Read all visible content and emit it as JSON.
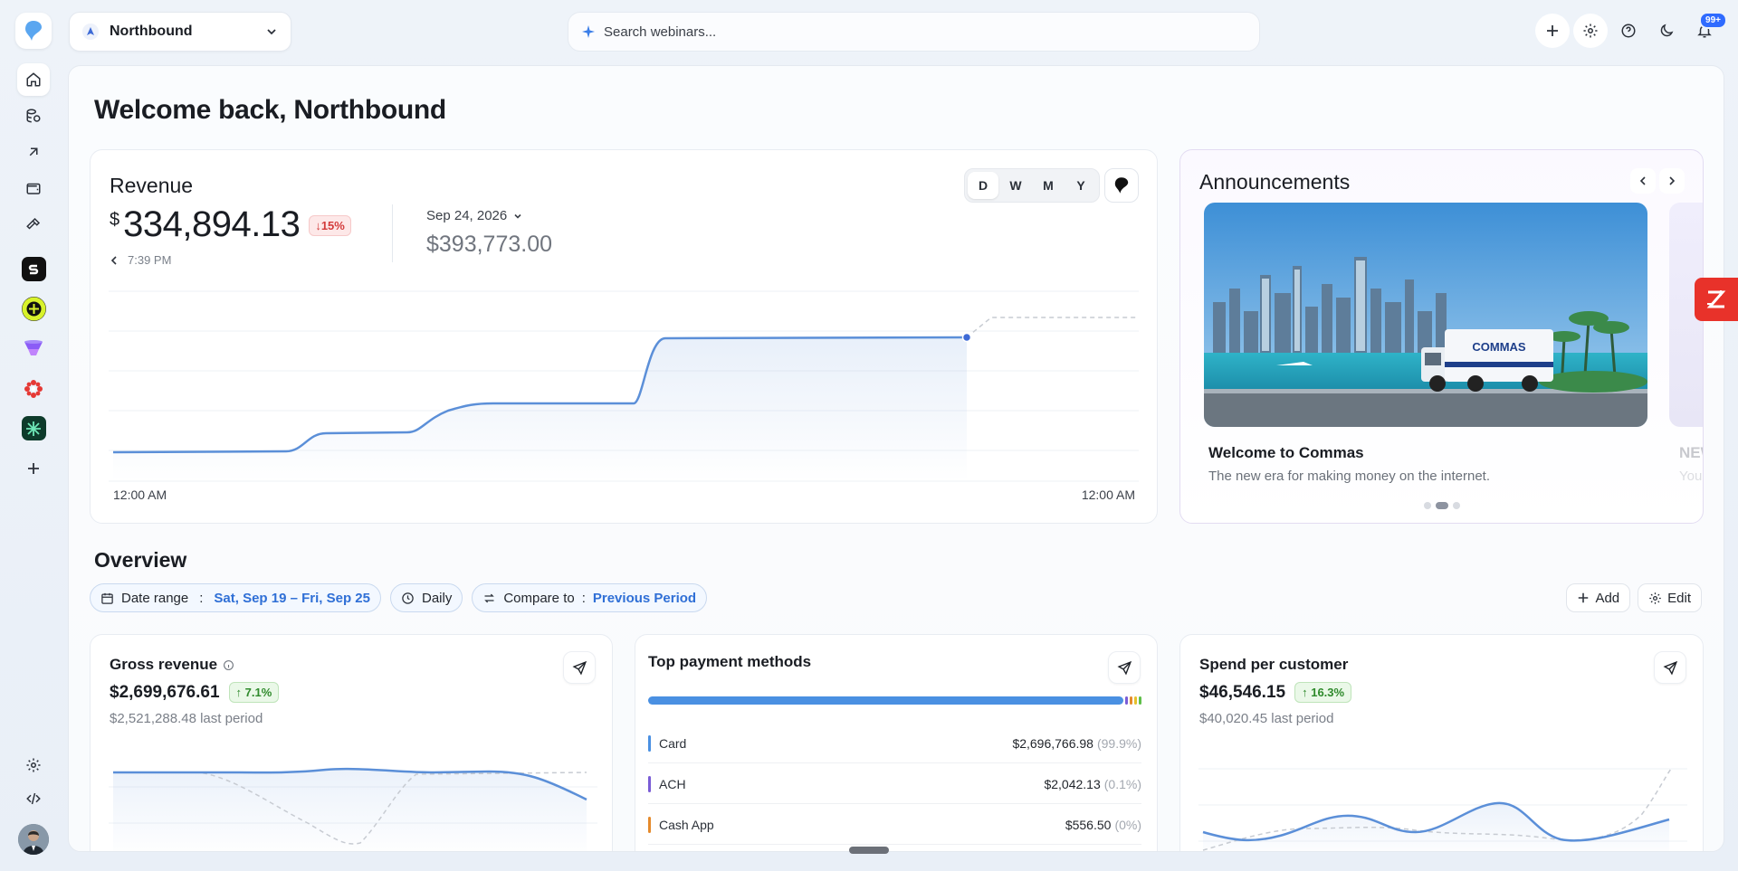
{
  "workspace": {
    "name": "Northbound"
  },
  "search": {
    "placeholder": "Search webinars..."
  },
  "notifications": {
    "badge": "99+"
  },
  "welcome": "Welcome back, Northbound",
  "revenue": {
    "title": "Revenue",
    "currency": "$",
    "amount": "334,894.13",
    "change": "15%",
    "time": "7:39 PM",
    "compare_date": "Sep 24, 2026",
    "compare_amount": "$393,773.00",
    "periods": [
      "D",
      "W",
      "M",
      "Y"
    ],
    "active_period": "D",
    "x_start": "12:00 AM",
    "x_end": "12:00 AM"
  },
  "announcements": {
    "title": "Announcements",
    "items": [
      {
        "title": "Welcome to Commas",
        "desc": "The new era for making money on the internet."
      },
      {
        "title": "NEW",
        "desc": "You"
      }
    ],
    "truck_label": "COMMAS"
  },
  "overview": {
    "title": "Overview",
    "date_label": "Date range",
    "date_value": "Sat, Sep 19 – Fri, Sep 25",
    "interval": "Daily",
    "compare_label": "Compare to",
    "compare_value": "Previous Period",
    "add_label": "Add",
    "edit_label": "Edit"
  },
  "gross": {
    "title": "Gross revenue",
    "value": "$2,699,676.61",
    "change": "7.1%",
    "last": "$2,521,288.48 last period"
  },
  "payments": {
    "title": "Top payment methods",
    "rows": [
      {
        "name": "Card",
        "value": "$2,696,766.98",
        "pct": "(99.9%)",
        "color": "#4a90e2"
      },
      {
        "name": "ACH",
        "value": "$2,042.13",
        "pct": "(0.1%)",
        "color": "#7a5cd6"
      },
      {
        "name": "Cash App",
        "value": "$556.50",
        "pct": "(0%)",
        "color": "#e58a2c"
      }
    ]
  },
  "spend": {
    "title": "Spend per customer",
    "value": "$46,546.15",
    "change": "16.3%",
    "last": "$40,020.45 last period"
  },
  "colors": {
    "accent": "#2f6fd6",
    "line": "#5b8fd8",
    "danger": "#d33b3b",
    "success": "#2f8a2c"
  }
}
